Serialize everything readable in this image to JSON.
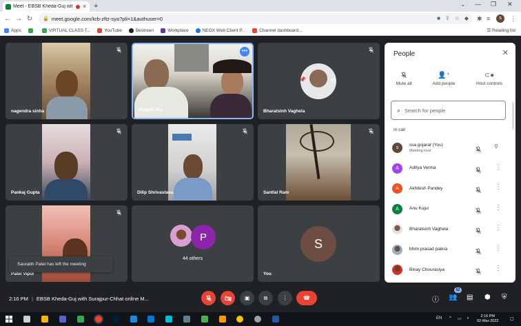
{
  "browser": {
    "tab_title": "Meet - EBSB Kheda-Guj wit",
    "url": "meet.google.com/krb-zftz-sya?pli=1&authuser=0",
    "profile_initial": "s"
  },
  "bookmarks": {
    "items": [
      {
        "label": "Apps",
        "color": "#4285f4"
      },
      {
        "label": "",
        "color": "#34a853"
      },
      {
        "label": "VIRTUAL CLASS T...",
        "color": "#34a853"
      },
      {
        "label": "YouTube",
        "color": "#ea4335"
      },
      {
        "label": "Bestreen",
        "color": "#202124"
      },
      {
        "label": "Workplace",
        "color": "#5b3aa8"
      },
      {
        "label": "NEOX Web Client P...",
        "color": "#1a73e8"
      },
      {
        "label": "Channel dashboard...",
        "color": "#ea4335"
      }
    ],
    "reading_list": "Reading list"
  },
  "tiles": {
    "nagendra": "nagendra sinha",
    "pragati": "Pragati Jha",
    "bharatsinh": "Bharatsinh Vaghela",
    "pankaj": "Pankaj Gupta",
    "dilip": "Dilip Shrivastava",
    "santlal": "Santlal Ram",
    "patel": "Patel Vipul",
    "others_initial": "P",
    "others_label": "44 others",
    "you_initial": "S",
    "you_label": "You"
  },
  "toast": "Saurabh Patel has left the meeting",
  "people_panel": {
    "title": "People",
    "actions": [
      {
        "label": "Mute all",
        "icon": "mic-off-icon"
      },
      {
        "label": "Add people",
        "icon": "person-add-icon"
      },
      {
        "label": "Host controls",
        "icon": "toggle-icon"
      }
    ],
    "search_placeholder": "Search for people",
    "section_label": "In call",
    "participants": [
      {
        "name": "ssa gujarat (You)",
        "subtitle": "Meeting host",
        "initial": "s",
        "color": "#5f4a3a",
        "action": "pin"
      },
      {
        "name": "Aditya Verma",
        "subtitle": "",
        "initial": "A",
        "color": "#a142f4",
        "action": "more"
      },
      {
        "name": "Akhilesh Pandey",
        "subtitle": "",
        "initial": "A",
        "color": "#f4511e",
        "action": "more"
      },
      {
        "name": "Anu Kujur",
        "subtitle": "",
        "initial": "A",
        "color": "#0b8043",
        "action": "more"
      },
      {
        "name": "Bharatsinh Vaghela",
        "subtitle": "",
        "initial": "",
        "color": "#c58a6a",
        "action": "more"
      },
      {
        "name": "bhim prasad paikra",
        "subtitle": "",
        "initial": "",
        "color": "#7b8a9a",
        "action": "more"
      },
      {
        "name": "Binay Chourasiya",
        "subtitle": "",
        "initial": "",
        "color": "#d93025",
        "action": "more"
      }
    ]
  },
  "controlbar": {
    "time": "2:16 PM",
    "meeting_title": "EBSB Kheda-Guj with Surajpur-Chhat online M...",
    "participants_badge": "52"
  },
  "taskbar": {
    "language": "EN",
    "clock_time": "2:16 PM",
    "clock_date": "02-Mar-2022"
  },
  "colors": {
    "accent": "#8ab4f8",
    "danger": "#ea4335",
    "tile_bg": "#3c4043",
    "stage_bg": "#202124"
  }
}
